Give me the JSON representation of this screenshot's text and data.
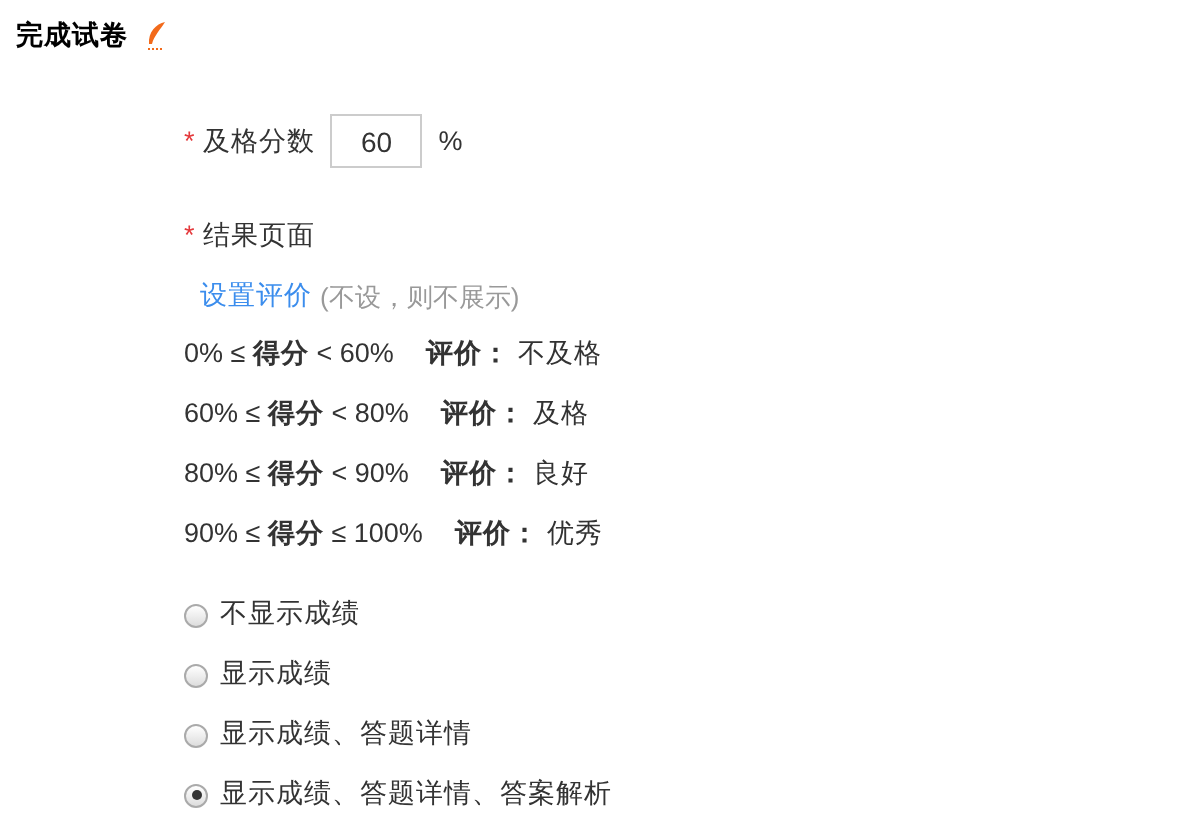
{
  "title": "完成试卷",
  "pass_score": {
    "required_mark": "*",
    "label": "及格分数",
    "value": "60",
    "unit": "%"
  },
  "result_page": {
    "required_mark": "*",
    "label": "结果页面"
  },
  "set_evaluation": {
    "link": "设置评价",
    "hint": "(不设，则不展示)"
  },
  "grades": [
    {
      "range": "0% ≤ **得分** < 60%",
      "label": "评价：",
      "value": "不及格"
    },
    {
      "range": "60% ≤ **得分** < 80%",
      "label": "评价：",
      "value": "及格"
    },
    {
      "range": "80% ≤ **得分** < 90%",
      "label": "评价：",
      "value": "良好"
    },
    {
      "range": "90% ≤ **得分** ≤ 100%",
      "label": "评价：",
      "value": "优秀"
    }
  ],
  "display_options": [
    {
      "label": "不显示成绩",
      "selected": false
    },
    {
      "label": "显示成绩",
      "selected": false
    },
    {
      "label": "显示成绩、答题详情",
      "selected": false
    },
    {
      "label": "显示成绩、答题详情、答案解析",
      "selected": true
    }
  ]
}
